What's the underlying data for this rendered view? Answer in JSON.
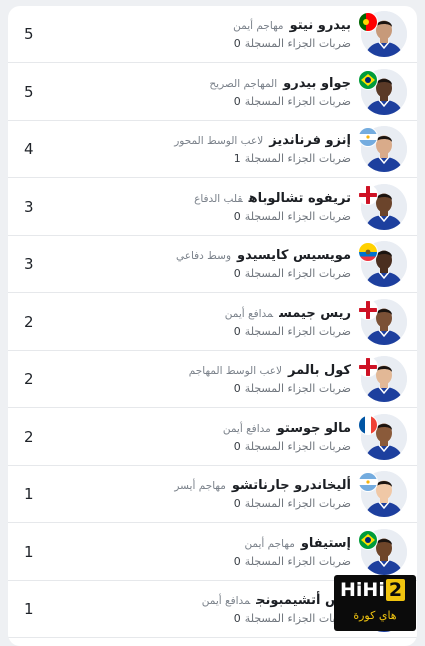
{
  "players": [
    {
      "count": "5",
      "name": "بيدرو نيتو",
      "position": "مهاجم أيمن",
      "stat_label": "ضربات الجزاء المسجلة",
      "stat_value": "0",
      "flag": "portugal-flag",
      "flag_colors": [
        "#006600",
        "#ff0000"
      ]
    },
    {
      "count": "5",
      "name": "جواو بيدرو",
      "position": "المهاجم الصريح",
      "stat_label": "ضربات الجزاء المسجلة",
      "stat_value": "0",
      "flag": "brazil-flag",
      "flag_colors": [
        "#009c3b",
        "#ffdf00",
        "#002776"
      ]
    },
    {
      "count": "4",
      "name": "إنزو فرنانديز",
      "position": "لاعب الوسط المحور",
      "stat_label": "ضربات الجزاء المسجلة",
      "stat_value": "1",
      "flag": "argentina-flag",
      "flag_colors": [
        "#74acdf",
        "#ffffff"
      ]
    },
    {
      "count": "3",
      "name": "تريفوه تشالوباه",
      "position": "قلب الدفاع",
      "stat_label": "ضربات الجزاء المسجلة",
      "stat_value": "0",
      "flag": "england-flag",
      "flag_colors": [
        "#ffffff",
        "#ce1124"
      ]
    },
    {
      "count": "3",
      "name": "مويسيس كايسيدو",
      "position": "وسط دفاعي",
      "stat_label": "ضربات الجزاء المسجلة",
      "stat_value": "0",
      "flag": "ecuador-flag",
      "flag_colors": [
        "#ffd100",
        "#0072ce",
        "#ef3340"
      ]
    },
    {
      "count": "2",
      "name": "ريس جيمس",
      "position": "مدافع أيمن",
      "stat_label": "ضربات الجزاء المسجلة",
      "stat_value": "0",
      "flag": "england-flag",
      "flag_colors": [
        "#ffffff",
        "#ce1124"
      ]
    },
    {
      "count": "2",
      "name": "كول بالمر",
      "position": "لاعب الوسط المهاجم",
      "stat_label": "ضربات الجزاء المسجلة",
      "stat_value": "0",
      "flag": "england-flag",
      "flag_colors": [
        "#ffffff",
        "#ce1124"
      ]
    },
    {
      "count": "2",
      "name": "مالو جوستو",
      "position": "مدافع أيمن",
      "stat_label": "ضربات الجزاء المسجلة",
      "stat_value": "0",
      "flag": "france-flag",
      "flag_colors": [
        "#0055a4",
        "#ffffff",
        "#ef4135"
      ]
    },
    {
      "count": "1",
      "name": "أليخاندرو جارناتشو",
      "position": "مهاجم أيسر",
      "stat_label": "ضربات الجزاء المسجلة",
      "stat_value": "0",
      "flag": "argentina-flag",
      "flag_colors": [
        "#74acdf",
        "#ffffff"
      ]
    },
    {
      "count": "1",
      "name": "إستيفاو",
      "position": "مهاجم أيمن",
      "stat_label": "ضربات الجزاء المسجلة",
      "stat_value": "0",
      "flag": "brazil-flag",
      "flag_colors": [
        "#009c3b",
        "#ffdf00",
        "#002776"
      ]
    },
    {
      "count": "1",
      "name": "وش أتشيمبونج",
      "position": "مدافع أيمن",
      "stat_label": "ضربات الجزاء المسجلة",
      "stat_value": "0",
      "flag": "england-flag",
      "flag_colors": [
        "#ffffff",
        "#ce1124"
      ]
    }
  ],
  "watermark": {
    "top_text": "HiHi",
    "top_number": "2",
    "bottom_text": "هاي كورة"
  },
  "colors": {
    "kit": "#1d3f9e",
    "kit_trim": "#ffffff",
    "skin_tones": [
      "#c79a7a",
      "#5a3a27",
      "#d9ab8a",
      "#6b442b",
      "#4a2e1f",
      "#7b5136",
      "#e2b896",
      "#8a5a3a",
      "#f0c8a6",
      "#6e4529",
      "#5c3b27"
    ]
  }
}
